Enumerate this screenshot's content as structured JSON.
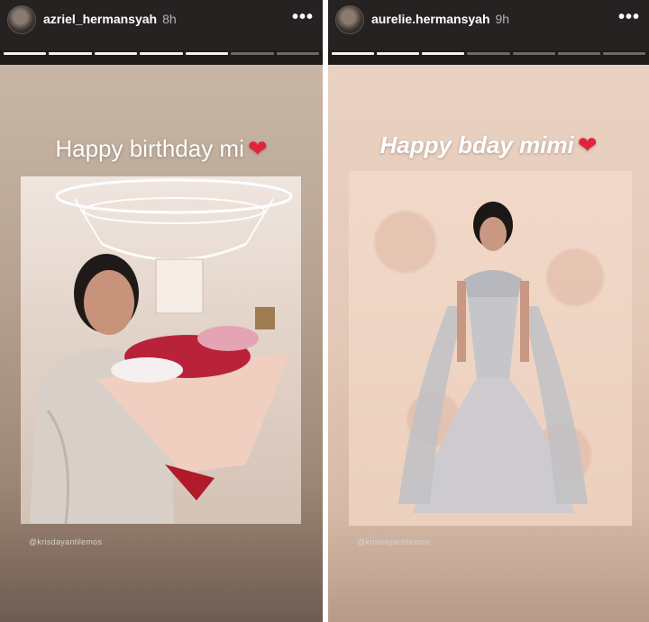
{
  "stories": {
    "left": {
      "username": "azriel_hermansyah",
      "time": "8h",
      "more_icon": "•••",
      "caption": "Happy birthday mi",
      "credit": "@krisdayantilemos",
      "progress_segments": 7,
      "progress_done": 5
    },
    "right": {
      "username": "aurelie.hermansyah",
      "time": "9h",
      "more_icon": "•••",
      "caption": "Happy bday mimi",
      "credit": "@krisdayantilemos",
      "progress_segments": 7,
      "progress_done": 3
    }
  },
  "heart_glyph": "❤",
  "heart_color": "#e0243a",
  "icons": [
    "avatar",
    "more-options-icon",
    "heart-icon"
  ]
}
